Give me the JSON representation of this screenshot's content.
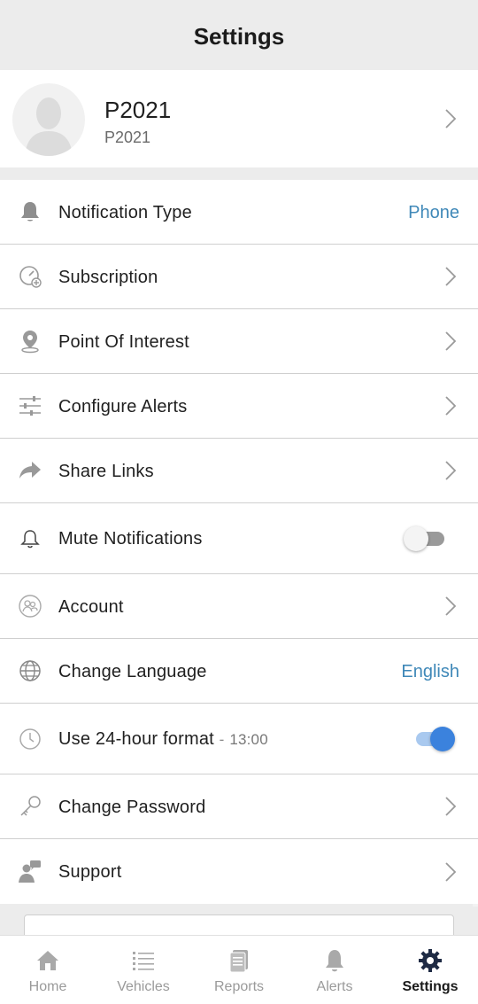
{
  "header": {
    "title": "Settings"
  },
  "profile": {
    "name": "P2021",
    "subtitle": "P2021"
  },
  "rows": [
    {
      "label": "Notification Type",
      "value": "Phone",
      "icon": "bell-filled-icon"
    },
    {
      "label": "Subscription",
      "icon": "subscription-icon"
    },
    {
      "label": "Point Of Interest",
      "icon": "map-pin-icon"
    },
    {
      "label": "Configure Alerts",
      "icon": "sliders-icon"
    },
    {
      "label": "Share Links",
      "icon": "share-arrow-icon"
    },
    {
      "label": "Mute Notifications",
      "icon": "bell-outline-icon",
      "toggle": false
    },
    {
      "label": "Account",
      "icon": "account-icon"
    },
    {
      "label": "Change Language",
      "value": "English",
      "icon": "globe-icon"
    },
    {
      "label": "Use 24-hour format",
      "separator": "-",
      "detail": "13:00",
      "icon": "clock-icon",
      "toggle": true
    },
    {
      "label": "Change Password",
      "icon": "key-icon"
    },
    {
      "label": "Support",
      "icon": "support-agent-icon"
    }
  ],
  "tabs": [
    {
      "label": "Home",
      "icon": "home-icon"
    },
    {
      "label": "Vehicles",
      "icon": "list-icon"
    },
    {
      "label": "Reports",
      "icon": "reports-icon"
    },
    {
      "label": "Alerts",
      "icon": "bell-icon"
    },
    {
      "label": "Settings",
      "icon": "gear-icon",
      "active": true
    }
  ],
  "colors": {
    "accent": "#3f88b8",
    "toggle_on": "#3b82dd",
    "background": "#ececec"
  }
}
